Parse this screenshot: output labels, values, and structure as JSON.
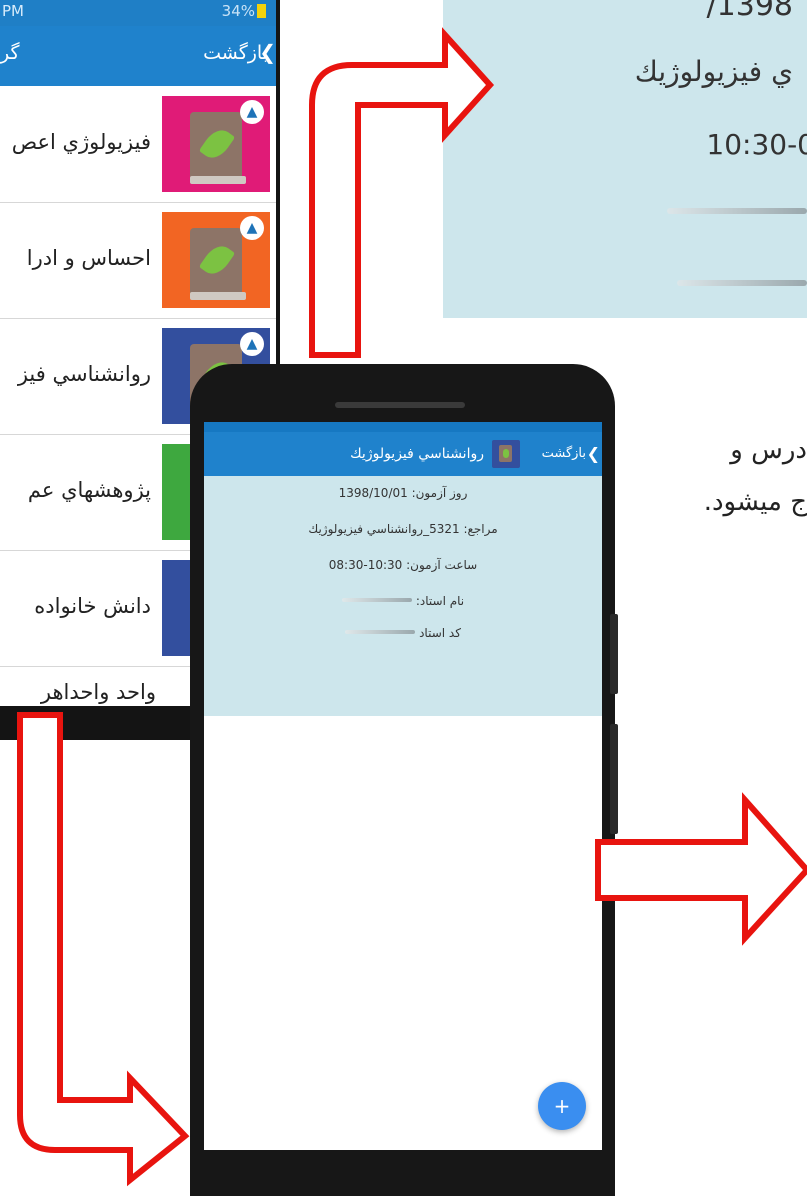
{
  "background_phone": {
    "status_time": "PM",
    "status_battery": "34%",
    "back_label": "بازگشت",
    "title": "گر",
    "items": [
      {
        "label": "فيزيولوژي اعص",
        "color": "#e01b77"
      },
      {
        "label": "احساس و ادرا",
        "color": "#f26523"
      },
      {
        "label": "روانشناسي فيز",
        "color": "#334f9e"
      },
      {
        "label": "پژوهشهاي عم",
        "color": "#3ea83f"
      },
      {
        "label": "دانش خانواده",
        "color": "#334f9e"
      }
    ],
    "plain_item": "واحد واحداهر"
  },
  "zoom_panel": {
    "line1": "1398/",
    "line2": "ي فيزيولوژيك",
    "line3": "10:30-0"
  },
  "paragraph": {
    "line1": "درس و",
    "line2": "ج ميشود."
  },
  "main_phone": {
    "back_label": "بازگشت",
    "title": "روانشناسي فيزيولوژيك",
    "exam_day": "روز آزمون: 1398/10/01",
    "reference": "مراجع: 5321_روانشناسي فيزيولوژيك",
    "exam_time": "ساعت آزمون: 10:30-08:30",
    "teacher_name_label": "نام استاد:",
    "teacher_code_label": "كد استاد",
    "fab_label": "+"
  },
  "colors": {
    "accent": "#1f82cc",
    "info_bg": "#cde6ec",
    "arrow": "#e8140f"
  }
}
